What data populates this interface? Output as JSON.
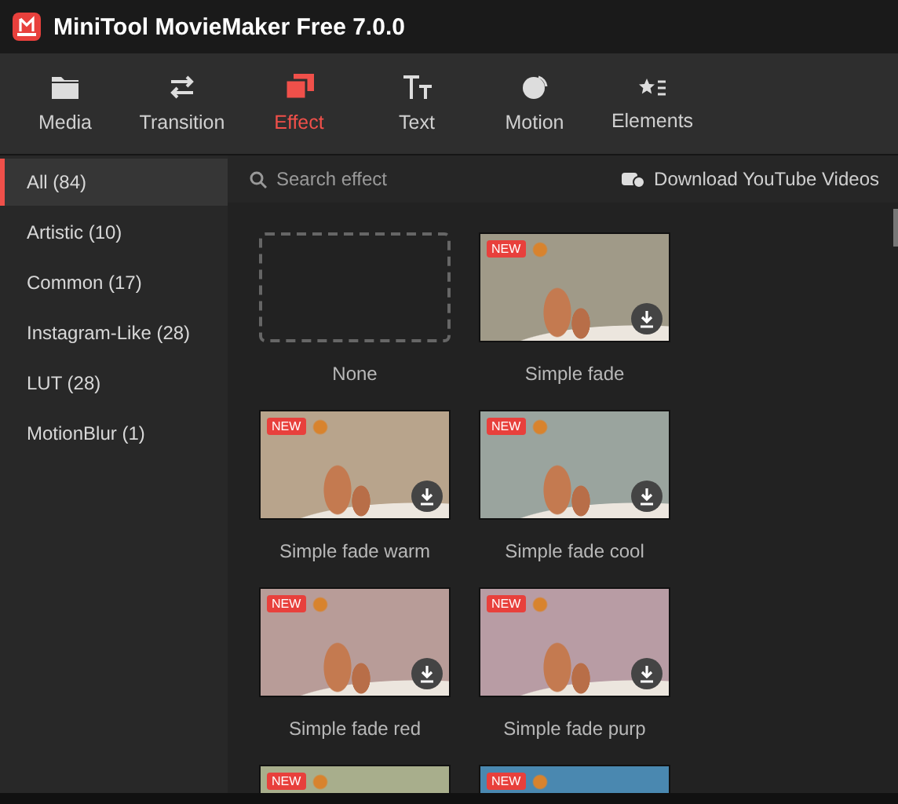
{
  "window": {
    "title": "MiniTool MovieMaker Free 7.0.0"
  },
  "toolbar": [
    {
      "label": "Media",
      "selected": false
    },
    {
      "label": "Transition",
      "selected": false
    },
    {
      "label": "Effect",
      "selected": true
    },
    {
      "label": "Text",
      "selected": false
    },
    {
      "label": "Motion",
      "selected": false
    },
    {
      "label": "Elements",
      "selected": false
    }
  ],
  "sidebar": {
    "items": [
      {
        "label": "All (84)",
        "selected": true
      },
      {
        "label": "Artistic (10)",
        "selected": false
      },
      {
        "label": "Common (17)",
        "selected": false
      },
      {
        "label": "Instagram-Like (28)",
        "selected": false
      },
      {
        "label": "LUT (28)",
        "selected": false
      },
      {
        "label": "MotionBlur (1)",
        "selected": false
      }
    ]
  },
  "search": {
    "placeholder": "Search effect"
  },
  "download_link": "Download YouTube Videos",
  "effects": [
    {
      "kind": "none",
      "label": "None"
    },
    {
      "kind": "photo",
      "label": "Simple fade",
      "color": "#a09a88",
      "badge": "NEW",
      "download": true
    },
    {
      "kind": "photo",
      "label": "Simple fade warm",
      "color": "#b8a48c",
      "badge": "NEW",
      "download": true
    },
    {
      "kind": "photo",
      "label": "Simple fade cool",
      "color": "#9aa49e",
      "badge": "NEW",
      "download": true
    },
    {
      "kind": "photo",
      "label": "Simple fade red",
      "color": "#b89c98",
      "badge": "NEW",
      "download": true
    },
    {
      "kind": "photo",
      "label": "Simple fade purp",
      "color": "#b89ca4",
      "badge": "NEW",
      "download": true
    },
    {
      "kind": "photo",
      "color": "#a8ae8c",
      "badge": "NEW",
      "download": false
    },
    {
      "kind": "photo",
      "color": "#4a88b0",
      "badge": "NEW",
      "download": false
    }
  ]
}
